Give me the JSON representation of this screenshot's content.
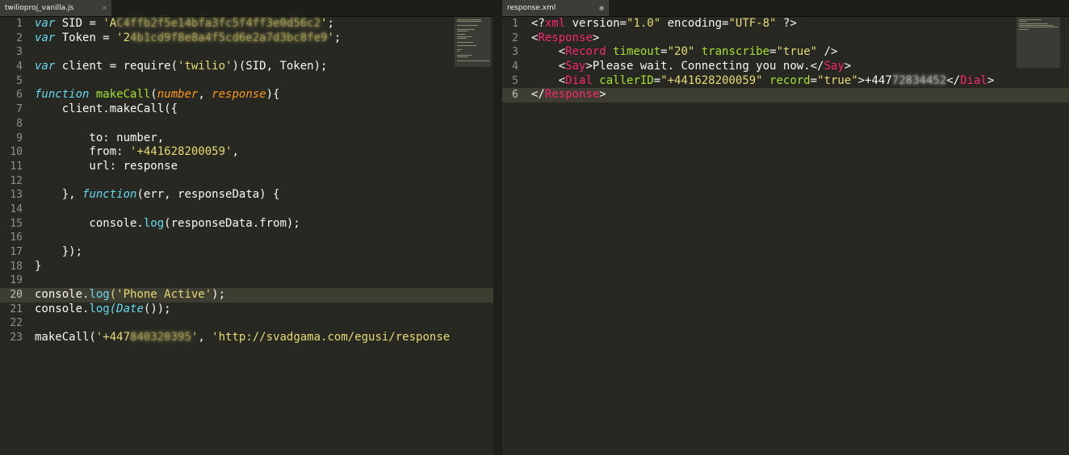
{
  "left_pane": {
    "tab": {
      "title": "twilioproj_vanilla.js",
      "close_glyph": "×"
    },
    "active_line": 20,
    "lines": [
      {
        "num": "1",
        "kw": "var",
        "a": " SID = ",
        "str": "'A",
        "blur": "C4ffb2f5e14bfa3fc5f4ff3e0d56c2",
        "str_end": "'",
        "end": ";"
      },
      {
        "num": "2",
        "kw": "var",
        "a": " Token = ",
        "str": "'2",
        "blur": "4b1cd9f8e8a4f5cd6e2a7d3bc8fe9",
        "str_end": "'",
        "end": ";"
      },
      {
        "num": "3"
      },
      {
        "num": "4",
        "kw": "var",
        "a": " client = require(",
        "str": "'twilio'",
        "end": ")(SID, Token);"
      },
      {
        "num": "5"
      },
      {
        "num": "6",
        "kw": "function",
        "fn": " makeCall",
        "a": "(",
        "arg1": "number",
        "b": ", ",
        "arg2": "response",
        "end": "){"
      },
      {
        "num": "7",
        "a": "    client.makeCall({"
      },
      {
        "num": "8"
      },
      {
        "num": "9",
        "a": "        to: number,"
      },
      {
        "num": "10",
        "a": "        from: ",
        "str": "'+441628200059'",
        "end": ","
      },
      {
        "num": "11",
        "a": "        url: response"
      },
      {
        "num": "12"
      },
      {
        "num": "13",
        "a": "    }, ",
        "kw": "function",
        "end": "(err, responseData) {"
      },
      {
        "num": "14"
      },
      {
        "num": "15",
        "a": "        console.",
        "prop": "log",
        "end": "(responseData.from);"
      },
      {
        "num": "16"
      },
      {
        "num": "17",
        "a": "    });"
      },
      {
        "num": "18",
        "a": "}"
      },
      {
        "num": "19"
      },
      {
        "num": "20",
        "a": "console.",
        "prop": "log",
        "str": "('Phone Active'",
        "end": ");"
      },
      {
        "num": "21",
        "a": "console.",
        "prop": "log",
        "cls": "(Date",
        "end": "());"
      },
      {
        "num": "22"
      },
      {
        "num": "23",
        "a": "makeCall(",
        "str": "'+447",
        "blur": "840320395",
        "str_end": "'",
        "mid": ", ",
        "str2": "'http://svadgama.com/egusi/response"
      }
    ]
  },
  "right_pane": {
    "tab": {
      "title": "response.xml",
      "modified_glyph": "●"
    },
    "active_line": 6,
    "lines": [
      {
        "num": "1",
        "p1": "<?",
        "pi": "xml",
        "a": " version=",
        "str": "\"1.0\"",
        "b": " encoding=",
        "str2": "\"UTF-8\"",
        "end": " ?>"
      },
      {
        "num": "2",
        "p1": "<",
        "tag": "Response",
        "end": ">"
      },
      {
        "num": "3",
        "p1": "    <",
        "tag": "Record",
        "attr": " timeout",
        "a": "=",
        "str": "\"20\"",
        "attr2": " transcribe",
        "b": "=",
        "str2": "\"true\"",
        "end": " />"
      },
      {
        "num": "4",
        "p1": "    <",
        "tag": "Say",
        "a": ">Please wait. Connecting you now.</",
        "tag2": "Say",
        "end": ">"
      },
      {
        "num": "5",
        "p1": "    <",
        "tag": "Dial",
        "attr": " callerID",
        "a": "=",
        "str": "\"+441628200059\"",
        "attr2": " record",
        "b": "=",
        "str2": "\"true\"",
        "c": ">+447",
        "blur": "72834452",
        "d": "</",
        "tag2": "Dial",
        "end": ">"
      },
      {
        "num": "6",
        "p1": "</",
        "tag": "Response",
        "end": ">"
      }
    ]
  },
  "colors": {
    "bg": "#272822",
    "keyword": "#66d9ef",
    "function": "#a6e22e",
    "string": "#e6db74",
    "tag": "#f92672",
    "argument": "#fd971f"
  }
}
